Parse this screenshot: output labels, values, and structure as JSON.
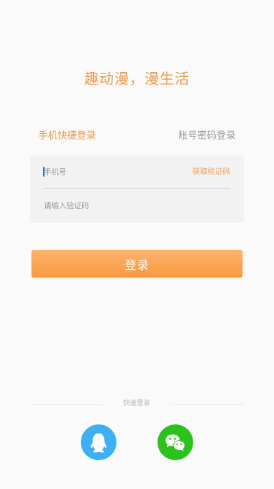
{
  "slogan": "趣动漫，漫生活",
  "tabs": {
    "quick_login": "手机快捷登录",
    "account_login": "账号密码登录"
  },
  "form": {
    "phone_placeholder": "手机号",
    "get_code_label": "获取验证码",
    "code_placeholder": "请输入验证码"
  },
  "login_button": "登录",
  "quick_login": {
    "label": "快速登录",
    "providers": [
      {
        "icon": "qq-icon",
        "color": "#3cb0f4"
      },
      {
        "icon": "wechat-icon",
        "color": "#2bc21c"
      }
    ]
  },
  "colors": {
    "accent": "#f39a4d",
    "qq": "#3cb0f4",
    "wechat": "#2bc21c",
    "background": "#fafafa"
  }
}
